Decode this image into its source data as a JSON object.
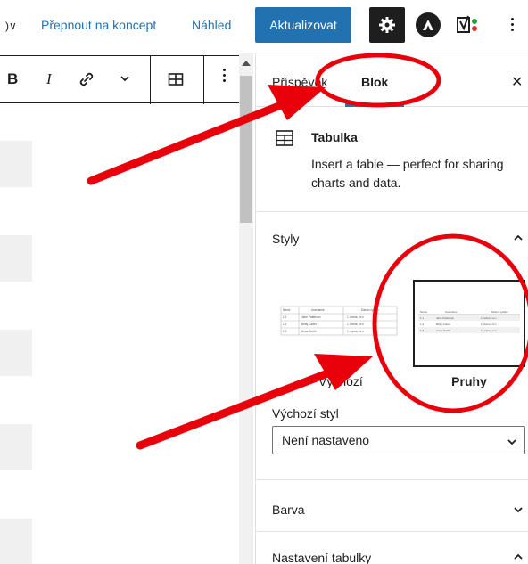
{
  "topbar": {
    "switch_to_draft": "Přepnout na koncept",
    "preview": "Náhled",
    "update": "Aktualizovat"
  },
  "sidebar": {
    "tabs": [
      "Příspěvek",
      "Blok"
    ],
    "block": {
      "title": "Tabulka",
      "description": "Insert a table — perfect for sharing charts and data."
    },
    "styles": {
      "heading": "Styly",
      "options": [
        "Výchozí",
        "Pruhy"
      ],
      "selected": "Pruhy"
    },
    "default_style": {
      "label": "Výchozí styl",
      "value": "Není nastaveno"
    },
    "panels": [
      "Barva",
      "Nastavení tabulky"
    ]
  },
  "preview_table": {
    "headers": [
      "Name",
      "Username",
      "Datum vydání"
    ],
    "rows": [
      [
        "1.1",
        "Jane Patterson",
        "1. ledna, xx:x"
      ],
      [
        "1.2",
        "Betty Carter",
        "1. ledna, xx:x"
      ],
      [
        "1.3",
        "Anna Smith",
        "1. srpna, xx:x"
      ]
    ]
  },
  "colors": {
    "accent": "#2271b1",
    "annotation": "#e8000b",
    "dark": "#1e1e1e"
  }
}
